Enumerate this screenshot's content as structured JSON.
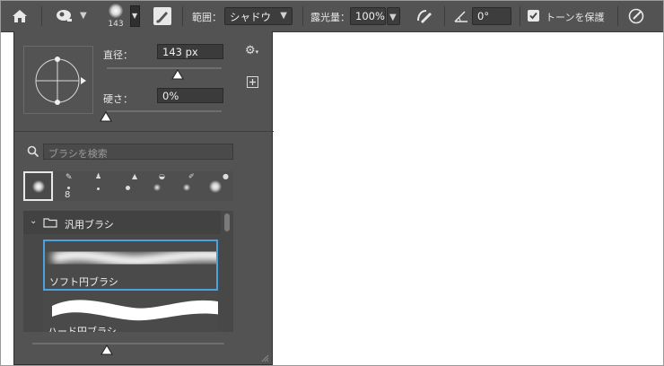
{
  "toolbar": {
    "brush_size_preview": "143",
    "range_label": "範囲：",
    "range_value": "シャドウ",
    "exposure_label": "露光量：",
    "exposure_value": "100%",
    "angle_value": "0°",
    "protect_tones_label": "トーンを保護",
    "protect_tones_checked": true,
    "icons": [
      "home-icon",
      "tool-preset-icon",
      "brush-settings-icon",
      "airbrush-icon",
      "angle-icon",
      "pressure-size-icon"
    ]
  },
  "brush_panel": {
    "diameter_label": "直径：",
    "diameter_value": "143 px",
    "hardness_label": "硬さ：",
    "hardness_value": "0%",
    "search_placeholder": "ブラシを検索",
    "recent_brushes": [
      {
        "label": "",
        "selected": true
      },
      {
        "label": "8",
        "selected": false
      },
      {
        "label": "",
        "selected": false
      },
      {
        "label": "",
        "selected": false
      },
      {
        "label": "",
        "selected": false
      },
      {
        "label": "",
        "selected": false
      },
      {
        "label": "",
        "selected": false
      }
    ],
    "group_name": "汎用ブラシ",
    "brushes": [
      {
        "name": "ソフト円ブラシ",
        "selected": true
      },
      {
        "name": "ハード円ブラシ",
        "selected": false
      }
    ]
  },
  "colors": {
    "panel": "#535353",
    "accent": "#4aa3df",
    "canvas": "#ffffff"
  }
}
